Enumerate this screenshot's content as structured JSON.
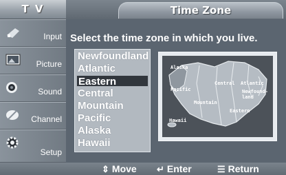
{
  "header": {
    "tv_label": "T V",
    "title": "Time Zone"
  },
  "sidebar": {
    "items": [
      {
        "label": "Input"
      },
      {
        "label": "Picture"
      },
      {
        "label": "Sound"
      },
      {
        "label": "Channel"
      },
      {
        "label": "Setup"
      }
    ]
  },
  "main": {
    "instruction": "Select the time zone in which you live.",
    "time_zones": [
      "Newfoundland",
      "Atlantic",
      "Eastern",
      "Central",
      "Mountain",
      "Pacific",
      "Alaska",
      "Hawaii"
    ],
    "selected": "Eastern",
    "map_labels": {
      "alaska": "Alaska",
      "pacific": "Pacific",
      "mountain": "Mountain",
      "central": "Central",
      "atlantic": "Atlantic",
      "newfoundland": "Newfound-\nland",
      "eastern": "Eastern",
      "hawaii": "Hawaii"
    }
  },
  "footer": {
    "move_label": "Move",
    "enter_label": "Enter",
    "return_label": "Return"
  },
  "colors": {
    "background": "#5b6570",
    "selected_row": "#31363c",
    "list_bg": "#b2b9c0"
  }
}
